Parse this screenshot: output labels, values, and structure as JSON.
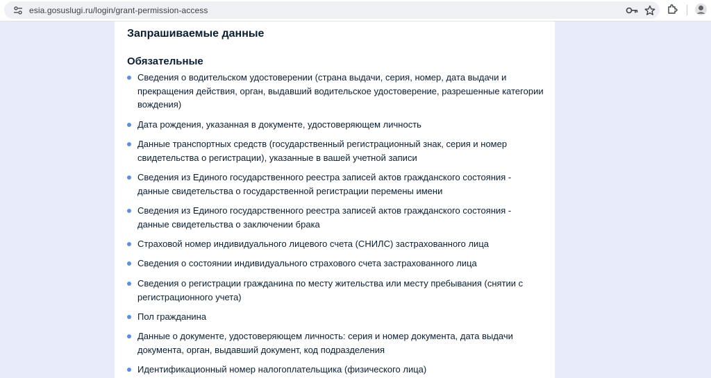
{
  "browser": {
    "url": "esia.gosuslugi.ru/login/grant-permission-access"
  },
  "content": {
    "section_title": "Запрашиваемые данные",
    "required_title": "Обязательные",
    "items": [
      "Сведения о водительском удостоверении (страна выдачи, серия, номер, дата выдачи и прекращения действия, орган, выдавший водительское удостоверение, разрешенные категории вождения)",
      "Дата рождения, указанная в документе, удостоверяющем личность",
      "Данные транспортных средств (государственный регистрационный знак, серия и номер свидетельства о регистрации), указанные в вашей учетной записи",
      "Сведения из Единого государственного реестра записей актов гражданского состояния - данные свидетельства о государственной регистрации перемены имени",
      "Сведения из Единого государственного реестра записей актов гражданского состояния - данные свидетельства о заключении брака",
      "Страховой номер индивидуального лицевого счета (СНИЛС) застрахованного лица",
      "Сведения о состоянии индивидуального страхового счета застрахованного лица",
      "Сведения о регистрации гражданина по месту жительства или месту пребывания (снятии с регистрационного учета)",
      "Пол гражданина",
      "Данные о документе, удостоверяющем личность: серия и номер документа, дата выдачи документа, орган, выдавший документ, код подразделения",
      "Идентификационный номер налогоплательщика (физического лица)"
    ]
  }
}
